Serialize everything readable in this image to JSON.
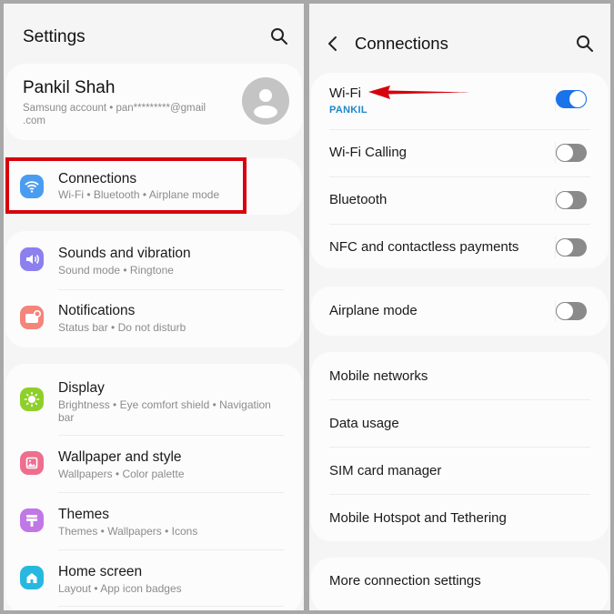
{
  "left": {
    "title": "Settings",
    "search_icon": "search-icon",
    "profile": {
      "name": "Pankil Shah",
      "subtitle_line1": "Samsung account  •  pan*********@gmail",
      "subtitle_line2": ".com"
    },
    "items": [
      {
        "label": "Connections",
        "sub": "Wi-Fi  •  Bluetooth  •  Airplane mode",
        "icon": "wifi-icon",
        "color": "#4a9cf0"
      },
      {
        "label": "Sounds and vibration",
        "sub": "Sound mode  •  Ringtone",
        "icon": "speaker-icon",
        "color": "#8c80ef"
      },
      {
        "label": "Notifications",
        "sub": "Status bar  •  Do not disturb",
        "icon": "notification-icon",
        "color": "#f5847a"
      },
      {
        "label": "Display",
        "sub": "Brightness  •  Eye comfort shield  •  Navigation",
        "sub2": "bar",
        "icon": "sun-icon",
        "color": "#8fcf2a"
      },
      {
        "label": "Wallpaper and style",
        "sub": "Wallpapers  •  Color palette",
        "icon": "image-icon",
        "color": "#ee6e8e"
      },
      {
        "label": "Themes",
        "sub": "Themes  •  Wallpapers  •  Icons",
        "icon": "brush-icon",
        "color": "#c177e6"
      },
      {
        "label": "Home screen",
        "sub": "Layout  •  App icon badges",
        "icon": "home-icon",
        "color": "#27b8e0"
      }
    ],
    "highlight_color": "#d7000f"
  },
  "right": {
    "title": "Connections",
    "toggles": [
      {
        "label": "Wi-Fi",
        "sub": "PANKIL",
        "on": true
      },
      {
        "label": "Wi-Fi Calling",
        "on": false
      },
      {
        "label": "Bluetooth",
        "on": false
      },
      {
        "label": "NFC and contactless payments",
        "on": false
      },
      {
        "label": "Airplane mode",
        "on": false
      }
    ],
    "links": [
      "Mobile networks",
      "Data usage",
      "SIM card manager",
      "Mobile Hotspot and Tethering"
    ],
    "more": "More connection settings",
    "accent": "#1a73e8",
    "sub_color": "#1e88c8",
    "arrow_color": "#d7000f"
  }
}
